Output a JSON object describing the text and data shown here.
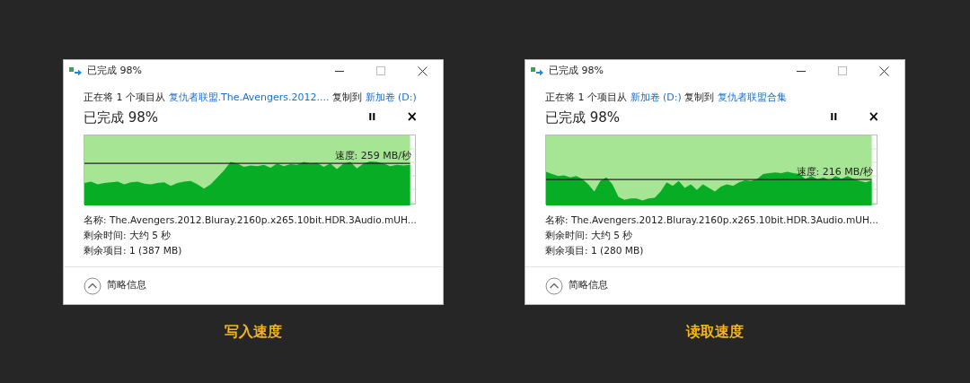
{
  "dialogs": [
    {
      "title": "已完成 98%",
      "message": [
        {
          "kind": "text",
          "text": "正在将 1 个项目从"
        },
        {
          "kind": "link",
          "text": "复仇者联盟.The.Avengers.2012...."
        },
        {
          "kind": "text",
          "text": "复制到"
        },
        {
          "kind": "link",
          "text": "新加卷 (D:)"
        }
      ],
      "progress_text": "已完成 98%",
      "pause": "II",
      "cancel": "×",
      "graph": {
        "level": 0.98,
        "speed": "速度: 259 MB/秒"
      },
      "details": [
        "名称: The.Avengers.2012.Bluray.2160p.x265.10bit.HDR.3Audio.mUH...",
        "剩余时间: 大约 5 秒",
        "剩余项目: 1 (387 MB)"
      ],
      "footer": "简略信息",
      "caption": "写入速度"
    },
    {
      "title": "已完成 98%",
      "message": [
        {
          "kind": "text",
          "text": "正在将 1 个项目从"
        },
        {
          "kind": "link",
          "text": "新加卷 (D:)"
        },
        {
          "kind": "text",
          "text": "复制到"
        },
        {
          "kind": "link",
          "text": "复仇者联盟合集"
        }
      ],
      "progress_text": "已完成 98%",
      "pause": "II",
      "cancel": "×",
      "graph": {
        "level": 0.98,
        "speed": "速度: 216 MB/秒"
      },
      "details": [
        "名称: The.Avengers.2012.Bluray.2160p.x265.10bit.HDR.3Audio.mUH...",
        "剩余时间: 大约 5 秒",
        "剩余项目: 1 (280 MB)"
      ],
      "footer": "简略信息",
      "caption": "读取速度"
    }
  ]
}
